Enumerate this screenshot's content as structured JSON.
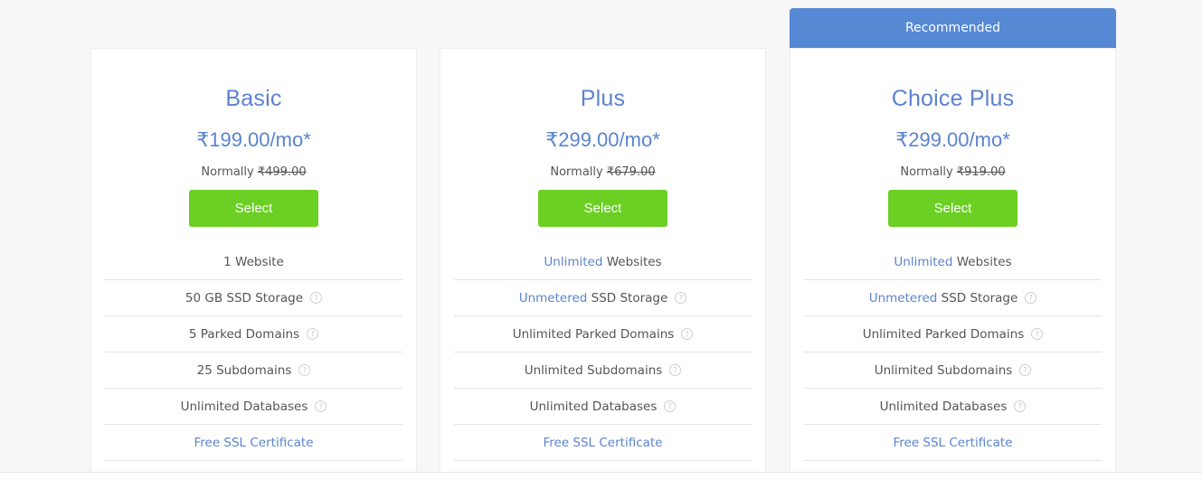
{
  "recommended_label": "Recommended",
  "select_label": "Select",
  "normally_label": "Normally",
  "plans": [
    {
      "name": "Basic",
      "price": "₹199.00/mo*",
      "normal_price": "₹499.00",
      "features": [
        {
          "highlight": "",
          "text": "1 Website",
          "help": false
        },
        {
          "highlight": "",
          "text": "50 GB SSD Storage",
          "help": true
        },
        {
          "highlight": "",
          "text": "5 Parked Domains",
          "help": true
        },
        {
          "highlight": "",
          "text": "25 Subdomains",
          "help": true
        },
        {
          "highlight": "",
          "text": "Unlimited Databases",
          "help": true
        },
        {
          "highlight": "Free SSL Certificate",
          "text": "",
          "help": false
        }
      ]
    },
    {
      "name": "Plus",
      "price": "₹299.00/mo*",
      "normal_price": "₹679.00",
      "features": [
        {
          "highlight": "Unlimited",
          "text": " Websites",
          "help": false
        },
        {
          "highlight": "Unmetered",
          "text": " SSD Storage",
          "help": true
        },
        {
          "highlight": "",
          "text": "Unlimited Parked Domains",
          "help": true
        },
        {
          "highlight": "",
          "text": "Unlimited Subdomains",
          "help": true
        },
        {
          "highlight": "",
          "text": "Unlimited Databases",
          "help": true
        },
        {
          "highlight": "Free SSL Certificate",
          "text": "",
          "help": false
        }
      ]
    },
    {
      "name": "Choice Plus",
      "price": "₹299.00/mo*",
      "normal_price": "₹919.00",
      "recommended": true,
      "features": [
        {
          "highlight": "Unlimited",
          "text": " Websites",
          "help": false
        },
        {
          "highlight": "Unmetered",
          "text": " SSD Storage",
          "help": true
        },
        {
          "highlight": "",
          "text": "Unlimited Parked Domains",
          "help": true
        },
        {
          "highlight": "",
          "text": "Unlimited Subdomains",
          "help": true
        },
        {
          "highlight": "",
          "text": "Unlimited Databases",
          "help": true
        },
        {
          "highlight": "Free SSL Certificate",
          "text": "",
          "help": false
        }
      ]
    }
  ],
  "help_icon_glyph": "?",
  "colors": {
    "accent_blue": "#5b83cf",
    "recommended_bg": "#5589d4",
    "select_green": "#6bcf24",
    "text_gray": "#555555"
  }
}
